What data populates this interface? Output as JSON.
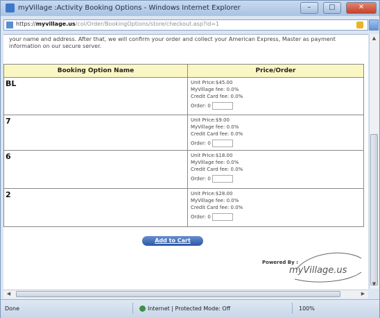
{
  "window": {
    "title": "myVillage :Activity Booking Options - Windows Internet Explorer",
    "buttons": {
      "minimize": "–",
      "maximize": "□",
      "close": "✕"
    }
  },
  "address": {
    "scheme": "https://",
    "host": "myvillage.us",
    "path": "/col/Order/BookingOptions/store/checkout.asp?id=1"
  },
  "page": {
    "intro": "your name and address. After that, we will confirm your order and collect your American Express, Master as payment information on our secure server.",
    "table": {
      "headers": [
        "Booking Option Name",
        "Price/Order"
      ],
      "rows": [
        {
          "name": "BL",
          "unit_price": "Unit Price:$45.00",
          "village_fee": "MyVillage fee: 0.0%",
          "card_fee": "Credit Card fee: 0.0%",
          "order_label": "Order: 0"
        },
        {
          "name": "7",
          "unit_price": "Unit Price:$9.00",
          "village_fee": "MyVillage fee: 0.0%",
          "card_fee": "Credit Card fee: 0.0%",
          "order_label": "Order: 0"
        },
        {
          "name": "6",
          "unit_price": "Unit Price:$18.00",
          "village_fee": "MyVillage fee: 0.0%",
          "card_fee": "Credit Card fee: 0.0%",
          "order_label": "Order: 0"
        },
        {
          "name": "2",
          "unit_price": "Unit Price:$28.00",
          "village_fee": "MyVillage fee: 0.0%",
          "card_fee": "Credit Card fee: 0.0%",
          "order_label": "Order: 0"
        }
      ]
    },
    "add_to_cart": "Add to Cart",
    "powered_by": "Powered By :",
    "logo_text": "myVillage.us"
  },
  "status": {
    "left": "Done",
    "zone": "Internet | Protected Mode: Off",
    "zoom": "100%"
  },
  "icons": {
    "page": "ie-page-icon",
    "lock": "lock-icon",
    "globe": "globe-icon"
  }
}
